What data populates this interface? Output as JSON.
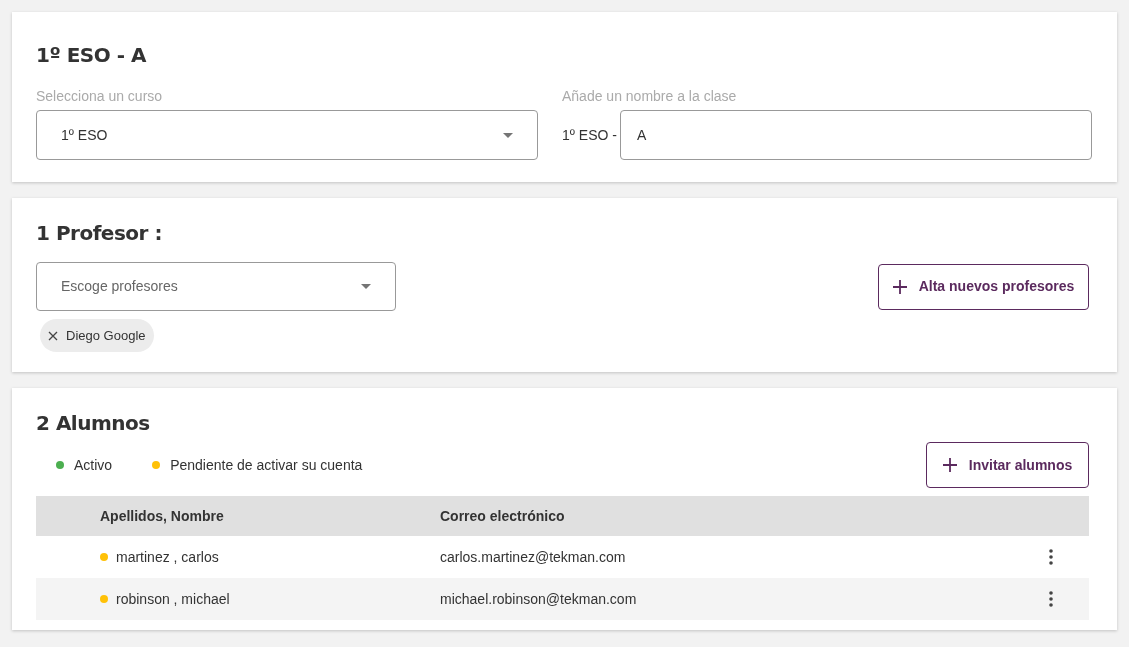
{
  "class_card": {
    "title": "1º ESO - A",
    "course_label": "Selecciona un curso",
    "course_value": "1º ESO",
    "name_label": "Añade un nombre a la clase",
    "name_prefix": "1º ESO -",
    "name_value": "A"
  },
  "teachers_card": {
    "title": "1 Profesor :",
    "select_placeholder": "Escoge profesores",
    "add_button": "Alta nuevos profesores",
    "chips": [
      "Diego Google"
    ]
  },
  "students_card": {
    "title": "2 Alumnos",
    "legend": [
      {
        "label": "Activo",
        "color": "#4caf50"
      },
      {
        "label": "Pendiente de activar su cuenta",
        "color": "#ffc107"
      }
    ],
    "invite_button": "Invitar alumnos",
    "table": {
      "columns": [
        "Apellidos, Nombre",
        "Correo electrónico"
      ],
      "rows": [
        {
          "name": "martinez , carlos",
          "email": "carlos.martinez@tekman.com",
          "color": "#ffc107"
        },
        {
          "name": "robinson , michael",
          "email": "michael.robinson@tekman.com",
          "color": "#ffc107"
        }
      ]
    }
  }
}
